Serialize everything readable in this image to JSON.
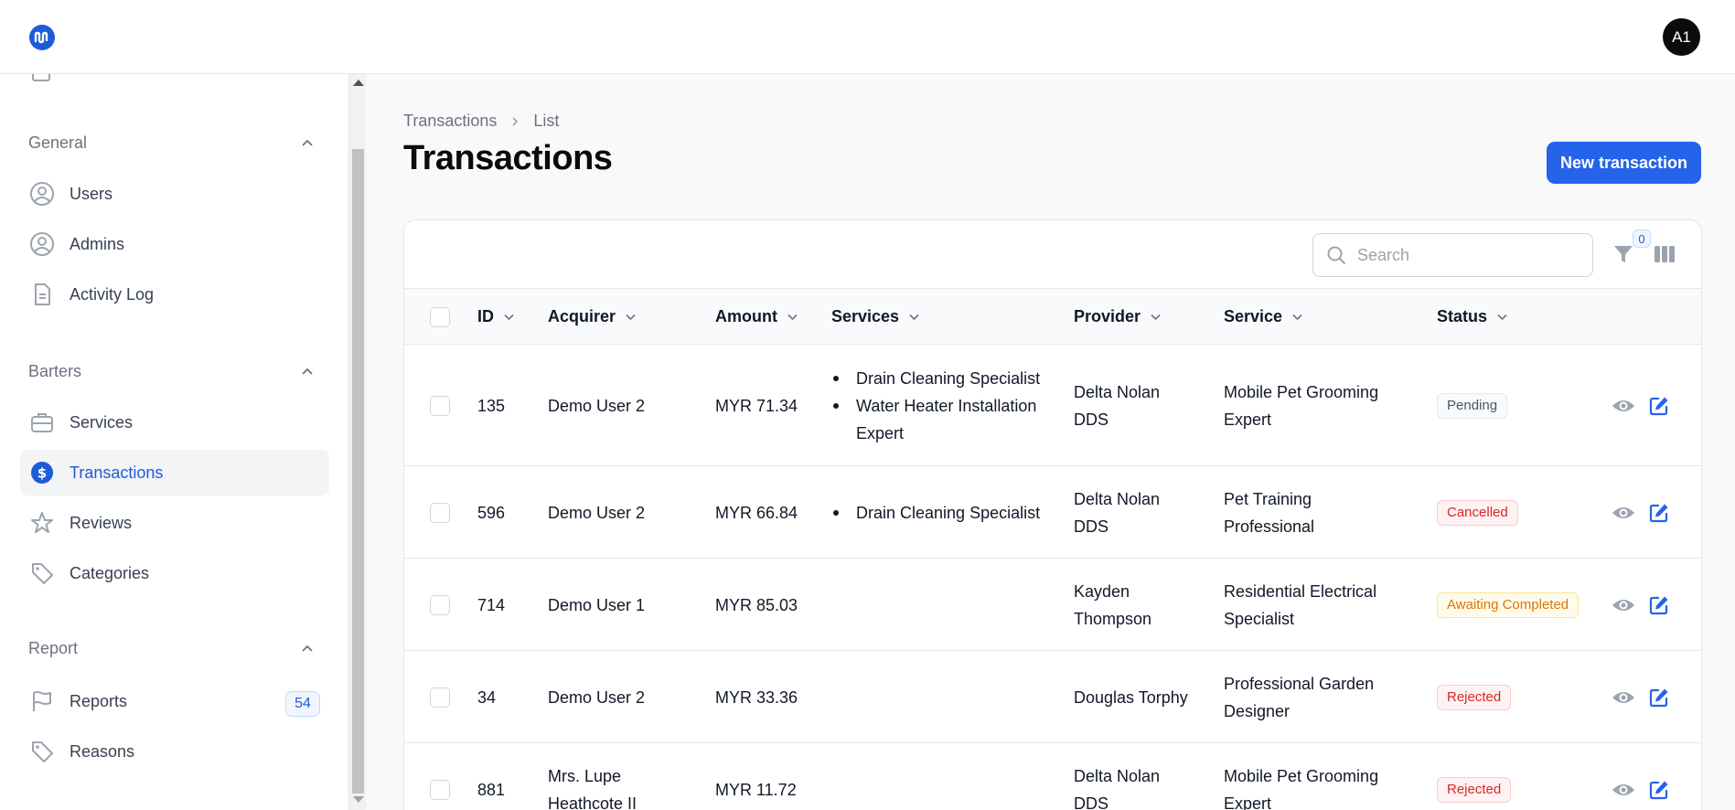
{
  "header": {
    "avatar_initials": "A1"
  },
  "sidebar": {
    "groups": [
      {
        "title": "General",
        "items": [
          {
            "label": "Users",
            "icon": "user-circle-icon"
          },
          {
            "label": "Admins",
            "icon": "user-circle-icon"
          },
          {
            "label": "Activity Log",
            "icon": "document-icon"
          }
        ]
      },
      {
        "title": "Barters",
        "items": [
          {
            "label": "Services",
            "icon": "briefcase-icon"
          },
          {
            "label": "Transactions",
            "icon": "dollar-circle-icon",
            "active": true
          },
          {
            "label": "Reviews",
            "icon": "star-icon"
          },
          {
            "label": "Categories",
            "icon": "tag-icon"
          }
        ]
      },
      {
        "title": "Report",
        "items": [
          {
            "label": "Reports",
            "icon": "flag-icon",
            "badge": "54"
          },
          {
            "label": "Reasons",
            "icon": "tag-icon"
          }
        ]
      }
    ]
  },
  "breadcrumb": [
    "Transactions",
    "List"
  ],
  "page": {
    "title": "Transactions",
    "new_button": "New transaction"
  },
  "table": {
    "search_placeholder": "Search",
    "filter_count": "0",
    "columns": [
      "ID",
      "Acquirer",
      "Amount",
      "Services",
      "Provider",
      "Service",
      "Status"
    ],
    "rows": [
      {
        "id": "135",
        "acquirer": [
          "Demo User 2"
        ],
        "amount": "MYR 71.34",
        "services": [
          "Drain Cleaning Specialist",
          "Water Heater Installation",
          "Expert"
        ],
        "provider": [
          "Delta Nolan",
          "DDS"
        ],
        "service": [
          "Mobile Pet Grooming",
          "Expert"
        ],
        "status": "Pending",
        "status_color": "gray"
      },
      {
        "id": "596",
        "acquirer": [
          "Demo User 2"
        ],
        "amount": "MYR 66.84",
        "services": [
          "Drain Cleaning Specialist"
        ],
        "provider": [
          "Delta Nolan",
          "DDS"
        ],
        "service": [
          "Pet Training",
          "Professional"
        ],
        "status": "Cancelled",
        "status_color": "red"
      },
      {
        "id": "714",
        "acquirer": [
          "Demo User 1"
        ],
        "amount": "MYR 85.03",
        "services": [],
        "provider": [
          "Kayden",
          "Thompson"
        ],
        "service": [
          "Residential Electrical",
          "Specialist"
        ],
        "status": "Awaiting Completed",
        "status_color": "amber"
      },
      {
        "id": "34",
        "acquirer": [
          "Demo User 2"
        ],
        "amount": "MYR 33.36",
        "services": [],
        "provider": [
          "Douglas Torphy"
        ],
        "service": [
          "Professional Garden",
          "Designer"
        ],
        "status": "Rejected",
        "status_color": "red"
      },
      {
        "id": "881",
        "acquirer": [
          "Mrs. Lupe",
          "Heathcote II"
        ],
        "amount": "MYR 11.72",
        "services": [],
        "provider": [
          "Delta Nolan",
          "DDS"
        ],
        "service": [
          "Mobile Pet Grooming",
          "Expert"
        ],
        "status": "Rejected",
        "status_color": "red"
      }
    ]
  }
}
